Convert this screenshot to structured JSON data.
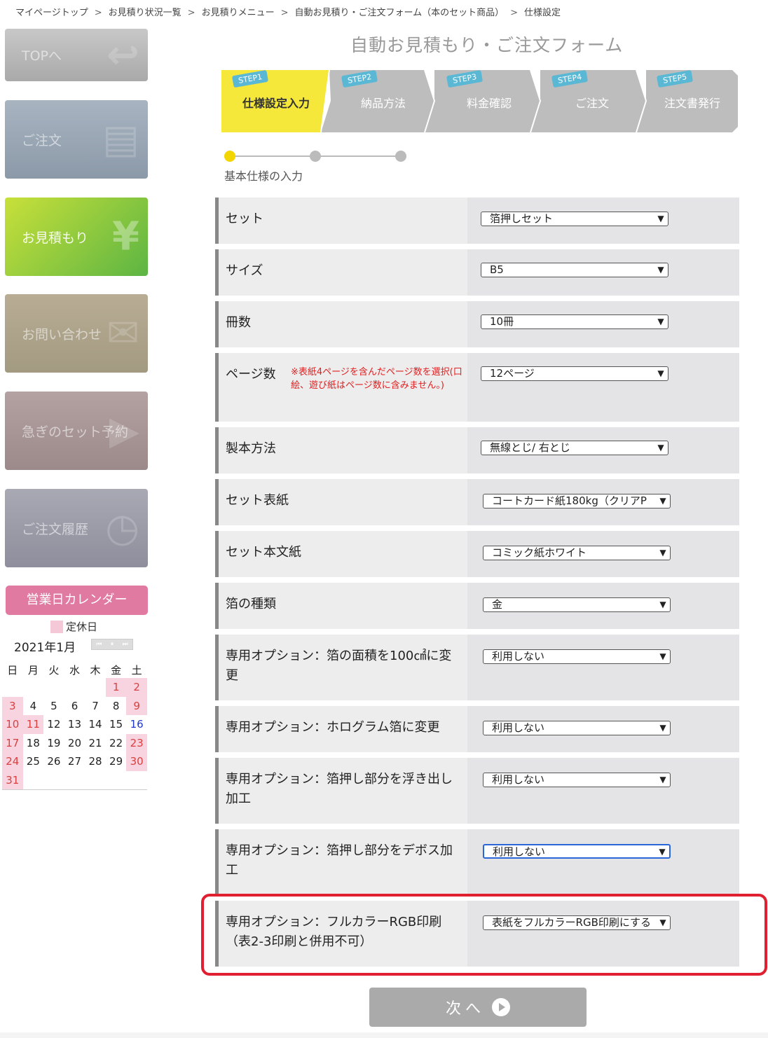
{
  "breadcrumb": {
    "items": [
      "マイページトップ",
      "お見積り状況一覧",
      "お見積りメニュー",
      "自動お見積り・ご注文フォーム（本のセット商品）",
      "仕様設定"
    ],
    "separator": ">"
  },
  "sidebar": {
    "top": "TOPへ",
    "order": "ご注文",
    "quote": "お見積もり",
    "contact": "お問い合わせ",
    "rush": "急ぎのセット予約",
    "history": "ご注文履歴"
  },
  "calendar": {
    "heading": "営業日カレンダー",
    "legend": "定休日",
    "month": "2021年1月",
    "weekdays": [
      "日",
      "月",
      "火",
      "水",
      "木",
      "金",
      "土"
    ],
    "weeks": [
      [
        "",
        "",
        "",
        "",
        "",
        "1",
        "2"
      ],
      [
        "3",
        "4",
        "5",
        "6",
        "7",
        "8",
        "9"
      ],
      [
        "10",
        "11",
        "12",
        "13",
        "14",
        "15",
        "16"
      ],
      [
        "17",
        "18",
        "19",
        "20",
        "21",
        "22",
        "23"
      ],
      [
        "24",
        "25",
        "26",
        "27",
        "28",
        "29",
        "30"
      ],
      [
        "31",
        "",
        "",
        "",
        "",
        "",
        ""
      ]
    ],
    "holiday_color": "#f8d4e0"
  },
  "form": {
    "title": "自動お見積もり・ご注文フォーム",
    "steps": [
      {
        "tag": "STEP1",
        "label": "仕様設定入力"
      },
      {
        "tag": "STEP2",
        "label": "納品方法"
      },
      {
        "tag": "STEP3",
        "label": "料金確認"
      },
      {
        "tag": "STEP4",
        "label": "ご注文"
      },
      {
        "tag": "STEP5",
        "label": "注文書発行"
      }
    ],
    "progress_label": "基本仕様の入力",
    "rows": [
      {
        "label": "セット",
        "value": "箔押しセット"
      },
      {
        "label": "サイズ",
        "value": "B5"
      },
      {
        "label": "冊数",
        "value": "10冊"
      },
      {
        "label": "ページ数",
        "note": "※表紙4ページを含んだページ数を選択(口絵、遊び紙はページ数に含みません。)",
        "value": "12ページ"
      },
      {
        "label": "製本方法",
        "value": "無線とじ/ 右とじ"
      },
      {
        "label": "セット表紙",
        "value": "コートカード紙180kg（クリアP"
      },
      {
        "label": "セット本文紙",
        "value": "コミック紙ホワイト"
      },
      {
        "label": "箔の種類",
        "value": "金"
      },
      {
        "label": "専用オプション：箔の面積を100㎠に変更",
        "value": "利用しない"
      },
      {
        "label": "専用オプション：ホログラム箔に変更",
        "value": "利用しない"
      },
      {
        "label": "専用オプション：箔押し部分を浮き出し加工",
        "value": "利用しない"
      },
      {
        "label": "専用オプション：箔押し部分をデボス加工",
        "value": "利用しない"
      },
      {
        "label": "専用オプション：フルカラーRGB印刷（表2-3印刷と併用不可）",
        "value": "表紙をフルカラーRGB印刷にする"
      }
    ],
    "next_label": "次 へ"
  },
  "colors": {
    "active_step": "#f5e83a",
    "inactive_step": "#bdbdbd",
    "step_tag": "#5bb8d4",
    "highlight_border": "#e02030",
    "note_red": "#e02020"
  }
}
